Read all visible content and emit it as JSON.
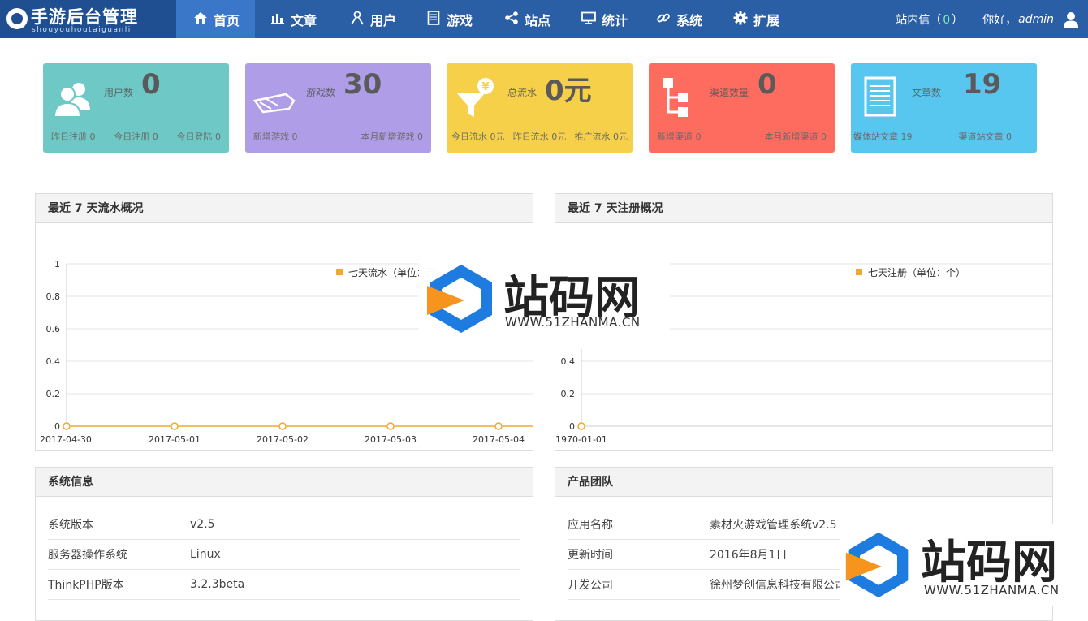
{
  "logo": {
    "title": "手游后台管理",
    "subtitle": "shouyouhoutaiguanli"
  },
  "nav": [
    {
      "label": "首页",
      "icon": "home-icon"
    },
    {
      "label": "文章",
      "icon": "bar-chart-icon"
    },
    {
      "label": "用户",
      "icon": "user-icon"
    },
    {
      "label": "游戏",
      "icon": "document-icon"
    },
    {
      "label": "站点",
      "icon": "share-icon"
    },
    {
      "label": "统计",
      "icon": "monitor-icon"
    },
    {
      "label": "系统",
      "icon": "link-icon"
    },
    {
      "label": "扩展",
      "icon": "gear-icon"
    }
  ],
  "header_right": {
    "messages_label": "站内信（",
    "messages_count": "0",
    "messages_close": "）",
    "greeting": "你好，",
    "username": "admin"
  },
  "cards": [
    {
      "label": "用户数",
      "value": "0",
      "icon": "users-icon",
      "foot": [
        "昨日注册 0",
        "今日注册 0",
        "今日登陆 0"
      ]
    },
    {
      "label": "游戏数",
      "value": "30",
      "icon": "gamepad-icon",
      "foot": [
        "新增游戏 0",
        "本月新增游戏 0"
      ]
    },
    {
      "label": "总流水",
      "value": "0元",
      "icon": "funnel-yen-icon",
      "foot": [
        "今日流水 0元",
        "昨日流水 0元",
        "推广流水 0元"
      ]
    },
    {
      "label": "渠道数量",
      "value": "0",
      "icon": "sitemap-icon",
      "foot": [
        "新增渠道 0",
        "本月新增渠道 0"
      ]
    },
    {
      "label": "文章数",
      "value": "19",
      "icon": "article-icon",
      "foot": [
        "媒体站文章 19",
        "渠道站文章 0"
      ]
    }
  ],
  "panels": {
    "revenue_title": "最近 7 天流水概况",
    "register_title": "最近 7 天注册概况",
    "sysinfo_title": "系统信息",
    "team_title": "产品团队"
  },
  "chart_data": [
    {
      "type": "line",
      "legend": "七天流水（单位：元）",
      "x": [
        "2017-04-30",
        "2017-05-01",
        "2017-05-02",
        "2017-05-03",
        "2017-05-04"
      ],
      "series": [
        {
          "name": "七天流水（单位：元）",
          "values": [
            0,
            0,
            0,
            0,
            0
          ]
        }
      ],
      "ylim": [
        0,
        1
      ],
      "yticks": [
        "1",
        "0.8",
        "0.6",
        "0.4",
        "0.2",
        "0"
      ],
      "color": "#f0a830"
    },
    {
      "type": "line",
      "legend": "七天注册（单位：个）",
      "x": [
        "1970-01-01"
      ],
      "series": [
        {
          "name": "七天注册（单位：个）",
          "values": [
            0
          ]
        }
      ],
      "ylim": [
        0,
        1
      ],
      "yticks": [
        "0.4",
        "0.2",
        "0"
      ],
      "color": "#f0a830"
    }
  ],
  "sysinfo": [
    {
      "key": "系统版本",
      "value": "v2.5"
    },
    {
      "key": "服务器操作系统",
      "value": "Linux"
    },
    {
      "key": "ThinkPHP版本",
      "value": "3.2.3beta"
    }
  ],
  "team": [
    {
      "key": "应用名称",
      "value": "素材火游戏管理系统v2.5"
    },
    {
      "key": "更新时间",
      "value": "2016年8月1日"
    },
    {
      "key": "开发公司",
      "value": "徐州梦创信息科技有限公司"
    }
  ],
  "watermark": {
    "text": "站码网",
    "url": "WWW.51ZHANMA.CN"
  },
  "colors": {
    "nav_bg": "#2a5fa5",
    "nav_active": "#3a77c9",
    "accent": "#f0a830"
  }
}
